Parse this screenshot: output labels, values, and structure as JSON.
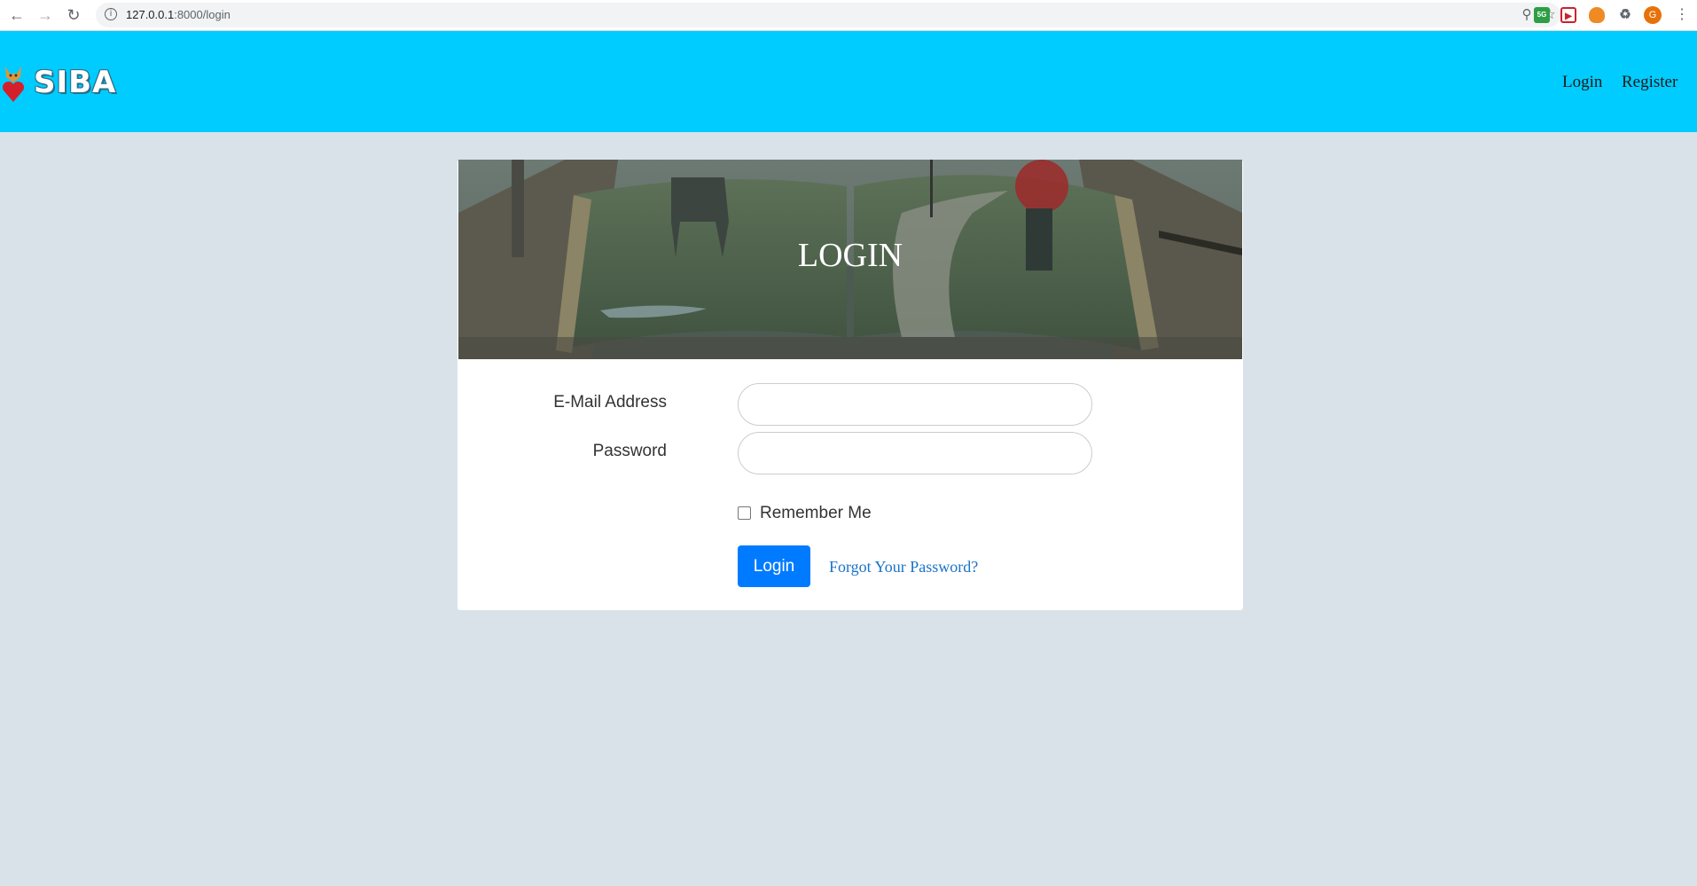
{
  "browser": {
    "url_host": "127.0.0.1",
    "url_path": ":8000/login",
    "profile_initial": "G",
    "ext_badge": "5G"
  },
  "site": {
    "brand": "SIBA",
    "nav": {
      "login": "Login",
      "register": "Register"
    }
  },
  "login_card": {
    "banner_title": "LOGIN",
    "email_label": "E-Mail Address",
    "email_value": "",
    "password_label": "Password",
    "password_value": "",
    "remember_label": "Remember Me",
    "submit_label": "Login",
    "forgot_label": "Forgot Your Password?"
  },
  "colors": {
    "header_bg": "#00ccff",
    "page_bg": "#d8e2e8",
    "primary_button": "#007bff",
    "link": "#1a73c8"
  }
}
